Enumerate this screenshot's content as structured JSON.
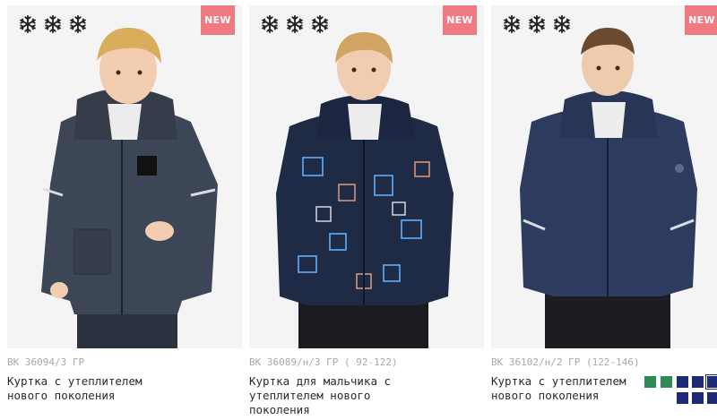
{
  "products": [
    {
      "badge": "NEW",
      "season_icon": "snowflake-icon",
      "sku": "ВК 36094/3 ГР",
      "title": "Куртка с утеплителем нового поколения"
    },
    {
      "badge": "NEW",
      "season_icon": "snowflake-icon",
      "sku": "ВК 36089/н/3 ГР ( 92-122)",
      "title": "Куртка для мальчика с утеплителем нового поколения"
    },
    {
      "badge": "NEW",
      "season_icon": "snowflake-icon",
      "sku": "ВК 36102/н/2 ГР (122-146)",
      "title": "Куртка с утеплителем нового поколения"
    }
  ],
  "colors": {
    "badge": "#f07a82",
    "sku_text": "#a8a8a8",
    "title_text": "#2a2a2a",
    "swatch_green": "#2e8b57",
    "swatch_navy": "#1d2a78"
  },
  "swatches": [
    {
      "color": "#2e8b57",
      "selected": false
    },
    {
      "color": "#2e8b57",
      "selected": false
    },
    {
      "color": "#1d2a78",
      "selected": false
    },
    {
      "color": "#1d2a78",
      "selected": false
    },
    {
      "color": "#1d2a78",
      "selected": true
    },
    {
      "color": "#1d2a78",
      "selected": false
    },
    {
      "color": "#1d2a78",
      "selected": false
    },
    {
      "color": "#1d2a78",
      "selected": false
    }
  ]
}
